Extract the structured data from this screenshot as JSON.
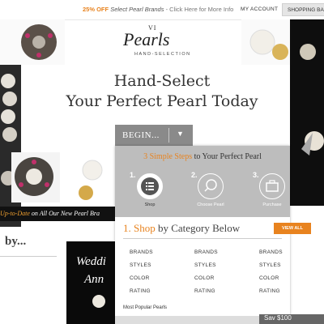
{
  "topbar": {
    "promo_off": "25% OFF",
    "promo_brands": "Select Pearl Brands",
    "promo_rest": " - Click Here for More Info",
    "account": "MY ACCOUNT",
    "bag": "SHOPPING BAG"
  },
  "logo": {
    "vi": "VI",
    "main": "Pearls",
    "sub": "HAND-SELECTION"
  },
  "hero": {
    "line1": "Hand-Select",
    "line2": "Your Perfect Pearl Today"
  },
  "begin": {
    "label": "BEGIN...",
    "arrow": "▼"
  },
  "strip": {
    "highlight": "Up-to-Date",
    "rest": " on All Our New Pearl Bra"
  },
  "left": {
    "by": "by...",
    "wed1": "Weddi",
    "wed2": "Ann"
  },
  "panel": {
    "steps_count": "3 Simple Steps",
    "steps_rest": " to Your Perfect Pearl",
    "steps": [
      {
        "num": "1.",
        "label": "Shop"
      },
      {
        "num": "2.",
        "label": "Choose Pearl"
      },
      {
        "num": "3.",
        "label": "Purchase"
      }
    ],
    "shop_num": "1.",
    "shop_word": "Shop",
    "shop_rest": " by Category Below",
    "view_all": "VIEW ALL",
    "columns": [
      [
        "BRANDS",
        "STYLES",
        "COLOR",
        "RATING"
      ],
      [
        "BRANDS",
        "STYLES",
        "COLOR",
        "RATING"
      ],
      [
        "BRANDS",
        "STYLES",
        "COLOR",
        "RATING"
      ]
    ],
    "popular": "Most Popular Pearls",
    "price": "Sav $100"
  },
  "colors": {
    "accent": "#e8831f",
    "panel_head": "#bdbdbd",
    "begin": "#8a8a8a"
  }
}
